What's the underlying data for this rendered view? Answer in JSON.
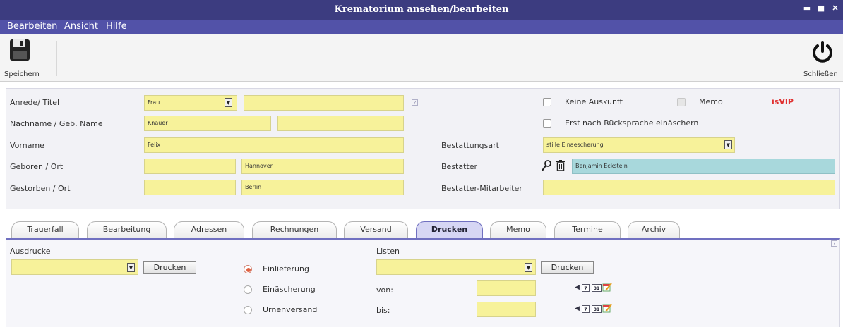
{
  "window": {
    "title": "Krematorium ansehen/bearbeiten"
  },
  "menu": {
    "items": [
      "Bearbeiten",
      "Ansicht",
      "Hilfe"
    ]
  },
  "toolbar": {
    "save_label": "Speichern",
    "close_label": "Schließen"
  },
  "form": {
    "anrede_label": "Anrede/ Titel",
    "anrede_value": "Frau",
    "titel_value": "",
    "nachname_label": "Nachname / Geb. Name",
    "nachname_value": "Knauer",
    "gebname_value": "",
    "vorname_label": "Vorname",
    "vorname_value": "Felix",
    "geboren_label": "Geboren / Ort",
    "geboren_date": "",
    "geboren_ort": "Hannover",
    "gestorben_label": "Gestorben / Ort",
    "gestorben_date": "",
    "gestorben_ort": "Berlin",
    "keine_auskunft_label": "Keine Auskunft",
    "memo_label": "Memo",
    "vip_label": "isVIP",
    "vip_color": "#e03030",
    "rueckspache_label": "Erst nach Rücksprache einäschern",
    "bestattungsart_label": "Bestattungsart",
    "bestattungsart_value": "stille Einaescherung",
    "bestatter_label": "Bestatter",
    "bestatter_value": "Benjamin Eckstein",
    "mitarbeiter_label": "Bestatter-Mitarbeiter",
    "mitarbeiter_value": ""
  },
  "tabs": [
    "Trauerfall",
    "Bearbeitung",
    "Adressen",
    "Rechnungen",
    "Versand",
    "Drucken",
    "Memo",
    "Termine",
    "Archiv"
  ],
  "active_tab": "Drucken",
  "drucken": {
    "ausdrucke_label": "Ausdrucke",
    "ausdrucke_value": "",
    "print_button": "Drucken",
    "radios": [
      "Einlieferung",
      "Einäscherung",
      "Urnenversand"
    ],
    "selected_radio": "Einlieferung",
    "listen_label": "Listen",
    "listen_value": "",
    "listen_button": "Drucken",
    "von_label": "von:",
    "von_value": "",
    "bis_label": "bis:",
    "bis_value": "",
    "cal_7": "7",
    "cal_31": "31"
  },
  "help_glyph": "?"
}
